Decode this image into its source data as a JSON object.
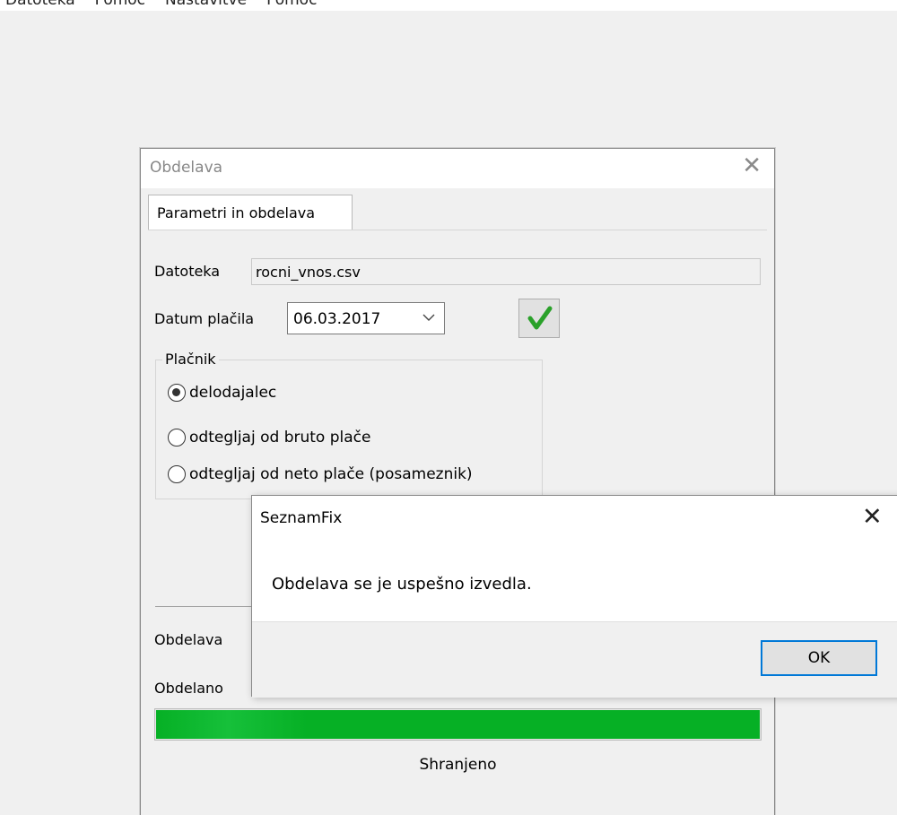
{
  "menubar": {
    "items": [
      "Datoteka",
      "Pomoč",
      "Nastavitve",
      "Pomoč"
    ]
  },
  "dialog": {
    "title": "Obdelava",
    "tab_label": "Parametri in obdelava",
    "file_label": "Datoteka",
    "file_value": "rocni_vnos.csv",
    "date_label": "Datum plačila",
    "date_value": "06.03.2017",
    "payer_group_label": "Plačnik",
    "radio_options": [
      {
        "label": "delodajalec",
        "checked": true
      },
      {
        "label": "odtegljaj od bruto plače",
        "checked": false
      },
      {
        "label": "odtegljaj od neto plače (posameznik)",
        "checked": false
      }
    ],
    "processing_label": "Obdelava",
    "processed_label": "Obdelano",
    "progress_percent": 100,
    "progress_color": "#06b025",
    "status_text": "Shranjeno"
  },
  "messagebox": {
    "title": "SeznamFix",
    "message": "Obdelava se je uspešno izvedla.",
    "ok_label": "OK",
    "accent": "#0078d7"
  }
}
